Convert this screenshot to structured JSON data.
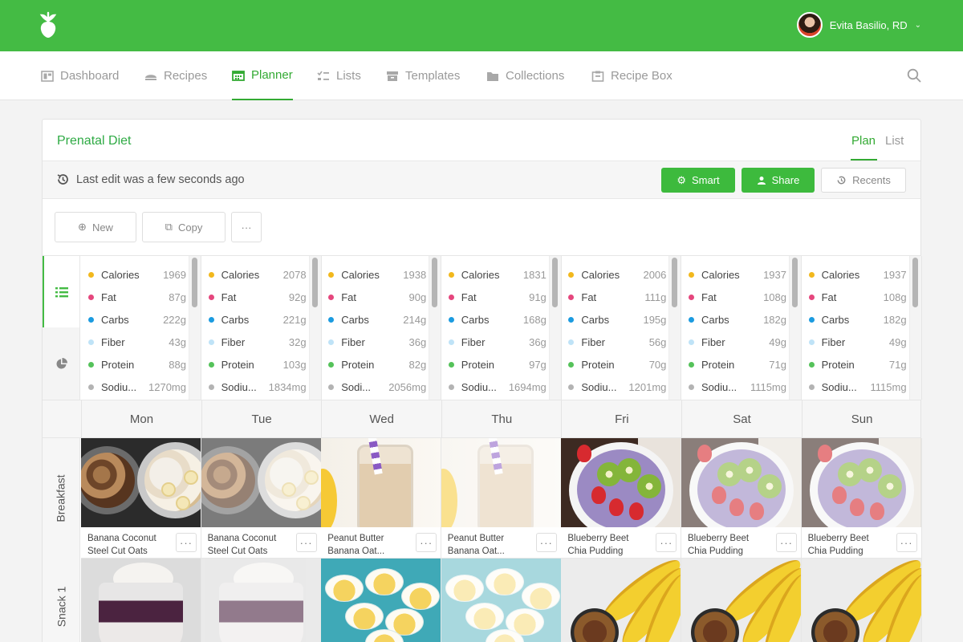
{
  "user": {
    "name": "Evita Basilio, RD"
  },
  "nav": [
    {
      "label": "Dashboard",
      "icon": "dashboard-icon"
    },
    {
      "label": "Recipes",
      "icon": "recipes-icon"
    },
    {
      "label": "Planner",
      "icon": "calendar-icon",
      "active": true
    },
    {
      "label": "Lists",
      "icon": "list-icon"
    },
    {
      "label": "Templates",
      "icon": "templates-icon"
    },
    {
      "label": "Collections",
      "icon": "folder-icon"
    },
    {
      "label": "Recipe Box",
      "icon": "recipe-box-icon"
    }
  ],
  "plan": {
    "title": "Prenatal Diet",
    "view_tabs": [
      "Plan",
      "List"
    ],
    "last_edit": "Last edit was a few seconds ago",
    "buttons": {
      "smart": "Smart",
      "share": "Share",
      "recents": "Recents",
      "new": "New",
      "copy": "Copy",
      "more": "···"
    }
  },
  "colors": {
    "brand_green": "#44bb44",
    "calories": "#f2b81d",
    "fat": "#e5467d",
    "carbs": "#1b9be0",
    "fiber": "#bfe3f7",
    "protein": "#55c25a",
    "sodium": "#b3b3b3"
  },
  "nutrient_labels": [
    "Calories",
    "Fat",
    "Carbs",
    "Fiber",
    "Protein"
  ],
  "days": [
    {
      "name": "Mon",
      "sodium_label": "Sodiu...",
      "values": [
        "1969",
        "87g",
        "222g",
        "43g",
        "88g",
        "1270mg"
      ]
    },
    {
      "name": "Tue",
      "sodium_label": "Sodiu...",
      "values": [
        "2078",
        "92g",
        "221g",
        "32g",
        "103g",
        "1834mg"
      ]
    },
    {
      "name": "Wed",
      "sodium_label": "Sodi...",
      "values": [
        "1938",
        "90g",
        "214g",
        "36g",
        "82g",
        "2056mg"
      ]
    },
    {
      "name": "Thu",
      "sodium_label": "Sodiu...",
      "values": [
        "1831",
        "91g",
        "168g",
        "36g",
        "97g",
        "1694mg"
      ]
    },
    {
      "name": "Fri",
      "sodium_label": "Sodiu...",
      "values": [
        "2006",
        "111g",
        "195g",
        "56g",
        "70g",
        "1201mg"
      ]
    },
    {
      "name": "Sat",
      "sodium_label": "Sodiu...",
      "values": [
        "1937",
        "108g",
        "182g",
        "49g",
        "71g",
        "1115mg"
      ]
    },
    {
      "name": "Sun",
      "sodium_label": "Sodiu...",
      "values": [
        "1937",
        "108g",
        "182g",
        "49g",
        "71g",
        "1115mg"
      ]
    }
  ],
  "meals": [
    {
      "label": "Breakfast",
      "items": [
        {
          "line1": "Banana Coconut",
          "line2": "Steel Cut Oats"
        },
        {
          "line1": "Banana Coconut",
          "line2": "Steel Cut Oats"
        },
        {
          "line1": "Peanut Butter",
          "line2": "Banana Oat..."
        },
        {
          "line1": "Peanut Butter",
          "line2": "Banana Oat..."
        },
        {
          "line1": "Blueberry Beet",
          "line2": "Chia Pudding"
        },
        {
          "line1": "Blueberry Beet",
          "line2": "Chia Pudding"
        },
        {
          "line1": "Blueberry Beet",
          "line2": "Chia Pudding"
        }
      ]
    },
    {
      "label": "Snack 1"
    }
  ]
}
